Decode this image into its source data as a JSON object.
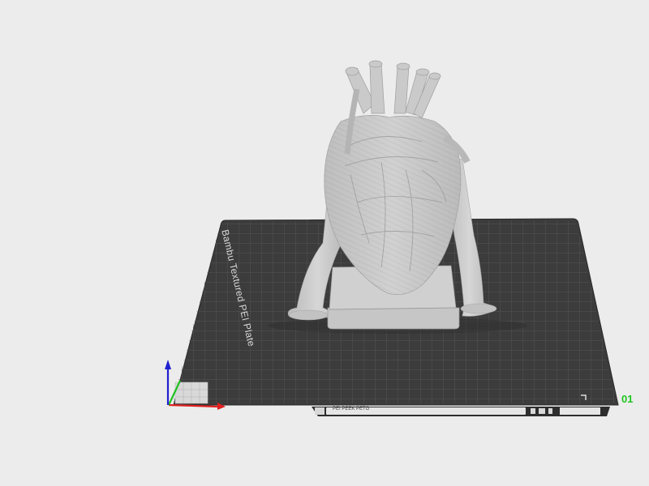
{
  "scene": {
    "plate_label": "Bambu Textured PEI Plate",
    "plate_number": "01",
    "strip_code": "PEI PEEK PETG",
    "strip_right_text": "",
    "colors": {
      "background": "#ececec",
      "plate": "#3c3c3c",
      "grid": "#5a5a5a",
      "model": "#c9c9c9",
      "axis_x": "#e02020",
      "axis_y": "#20c020",
      "axis_z": "#2020d0",
      "plate_number": "#1ec51e"
    }
  }
}
